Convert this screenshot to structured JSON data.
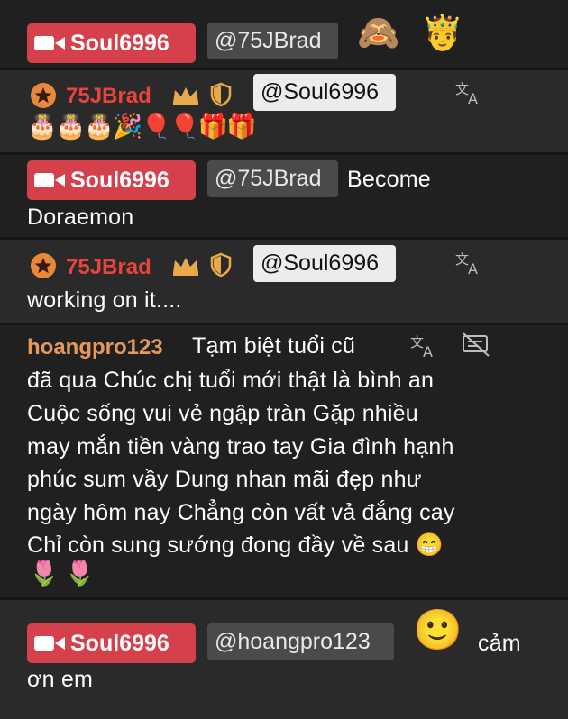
{
  "messages": [
    {
      "host": "Soul6996",
      "mention": "@75JBrad",
      "emoji": "🙈🤴"
    },
    {
      "user": "75JBrad",
      "mention": "@Soul6996",
      "emojis": "🎂🎂🎂🎉🎈🎈🎁🎁"
    },
    {
      "host": "Soul6996",
      "mention": "@75JBrad",
      "text_a": "Become",
      "text_b": "Doraemon"
    },
    {
      "user": "75JBrad",
      "mention": "@Soul6996",
      "text": "working on it...."
    },
    {
      "user": "hoangpro123",
      "lines": [
        "Tạm biệt tuổi cũ",
        "đã qua Chúc chị tuổi mới thật là bình an",
        "Cuộc sống vui vẻ ngập tràn Gặp nhiều",
        "may mắn tiền vàng trao tay Gia đình hạnh",
        "phúc sum vầy Dung nhan mãi đẹp như",
        "ngày hôm nay Chẳng còn vất vả đắng cay",
        "Chỉ còn sung sướng đong đầy về sau 😁",
        "🌷🌷"
      ]
    },
    {
      "host": "Soul6996",
      "mention": "@hoangpro123",
      "emoji": "🙂",
      "text_a": "cảm",
      "text_b": "ơn em"
    }
  ],
  "icons": {
    "host": "camera-icon",
    "level": "star-badge-icon",
    "crown": "crown-icon",
    "shield": "shield-icon",
    "translate": "translate-icon",
    "hide": "hide-translation-icon"
  },
  "colors": {
    "background": "#202020",
    "host_badge": "#d5404a",
    "user_red": "#e8433e",
    "user_orange": "#e59a5c",
    "gold": "#e8a94a"
  }
}
